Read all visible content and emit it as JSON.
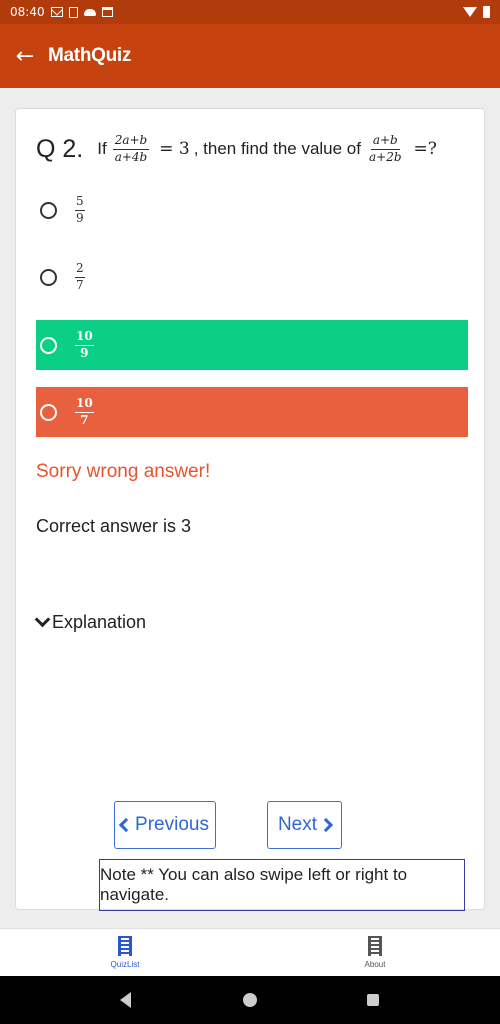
{
  "status_bar": {
    "time": "08:40"
  },
  "app_bar": {
    "title": "MathQuiz"
  },
  "question": {
    "number": "Q 2.",
    "prefix": "If",
    "frac1": {
      "num": "2a+b",
      "den": "a+4b"
    },
    "middle_eq": "= 3",
    "middle_text": ", then find the value of",
    "frac2": {
      "num": "a+b",
      "den": "a+2b"
    },
    "suffix": "=?"
  },
  "options": [
    {
      "num": "5",
      "den": "9",
      "state": "neutral"
    },
    {
      "num": "2",
      "den": "7",
      "state": "neutral"
    },
    {
      "num": "10",
      "den": "9",
      "state": "correct"
    },
    {
      "num": "10",
      "den": "7",
      "state": "wrong"
    }
  ],
  "feedback": "Sorry wrong answer!",
  "correct_answer": "Correct answer is 3",
  "explanation_label": "Explanation",
  "nav": {
    "previous": "Previous",
    "next": "Next"
  },
  "note": "Note ** You can also swipe left or right to navigate.",
  "bottom_nav": [
    {
      "label": "QuizList",
      "active": true
    },
    {
      "label": "About",
      "active": false
    }
  ],
  "colors": {
    "app_bar": "#c6420e",
    "correct": "#0bcf85",
    "wrong": "#e8603e",
    "accent": "#2e67d4"
  }
}
